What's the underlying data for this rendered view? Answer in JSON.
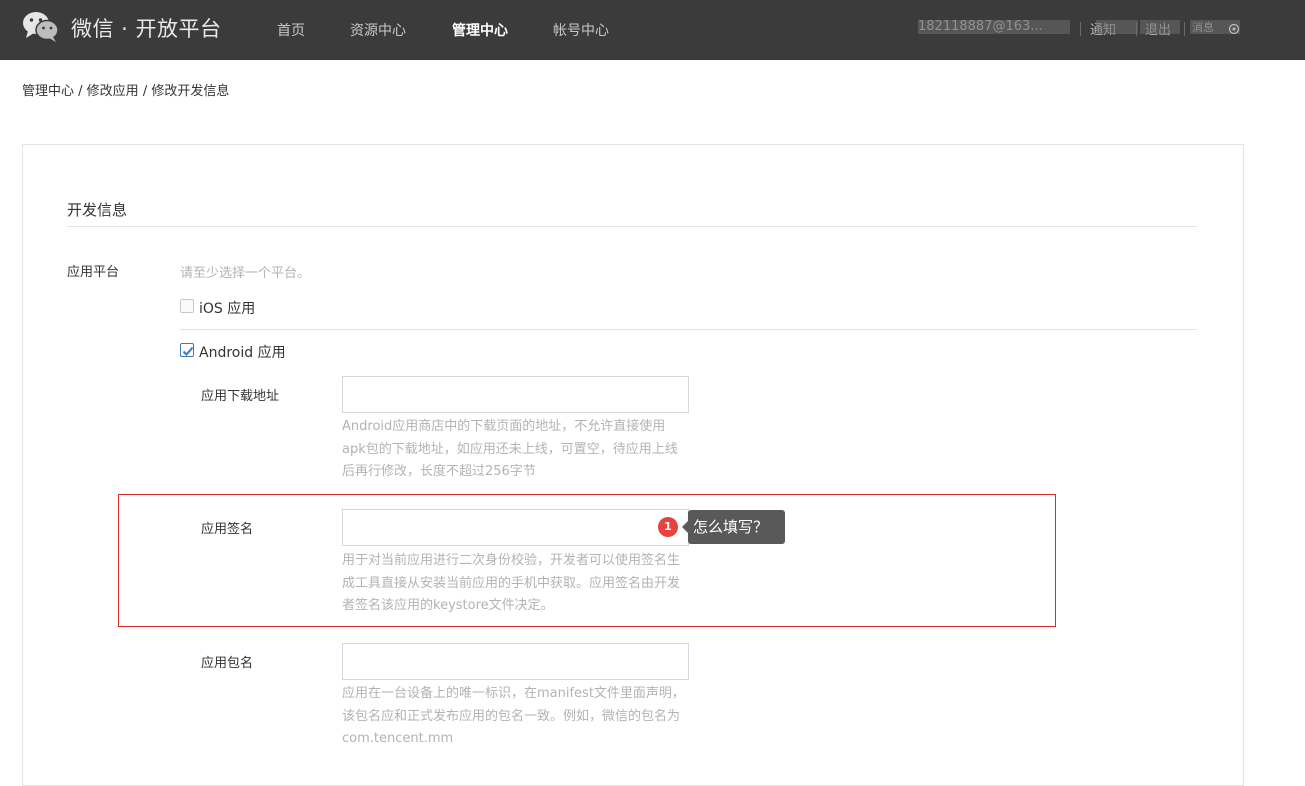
{
  "header": {
    "logo_text": "微信 · 开放平台",
    "nav": [
      {
        "label": "首页",
        "active": false
      },
      {
        "label": "资源中心",
        "active": false
      },
      {
        "label": "管理中心",
        "active": true
      },
      {
        "label": "帐号中心",
        "active": false
      }
    ],
    "account": "182118887@163...",
    "notify_label": "通知",
    "logout_label": "退出",
    "messages_label": "消息"
  },
  "breadcrumb": {
    "items": [
      "管理中心",
      "修改应用",
      "修改开发信息"
    ],
    "separator": " / "
  },
  "form": {
    "section_title": "开发信息",
    "platform_label": "应用平台",
    "platform_hint": "请至少选择一个平台。",
    "ios_option": {
      "label": "iOS 应用",
      "checked": false
    },
    "android_option": {
      "label": "Android 应用",
      "checked": true
    },
    "download_url": {
      "label": "应用下载地址",
      "value": "",
      "help": "Android应用商店中的下载页面的地址，不允许直接使用apk包的下载地址，如应用还未上线，可置空，待应用上线后再行修改，长度不超过256字节"
    },
    "signature": {
      "label": "应用签名",
      "value": "",
      "help": "用于对当前应用进行二次身份校验，开发者可以使用签名生成工具直接从安装当前应用的手机中获取。应用签名由开发者签名该应用的keystore文件决定。"
    },
    "package_name": {
      "label": "应用包名",
      "value": "",
      "help": "应用在一台设备上的唯一标识，在manifest文件里面声明，该包名应和正式发布应用的包名一致。例如，微信的包名为com.tencent.mm"
    }
  },
  "annotation": {
    "badge_number": "1",
    "tooltip_text": "怎么填写？",
    "highlight_color": "#d62b2b"
  },
  "colors": {
    "header_bg": "#3b3b3b",
    "checkbox_accent": "#3a78c8",
    "badge_red": "#e64340"
  }
}
